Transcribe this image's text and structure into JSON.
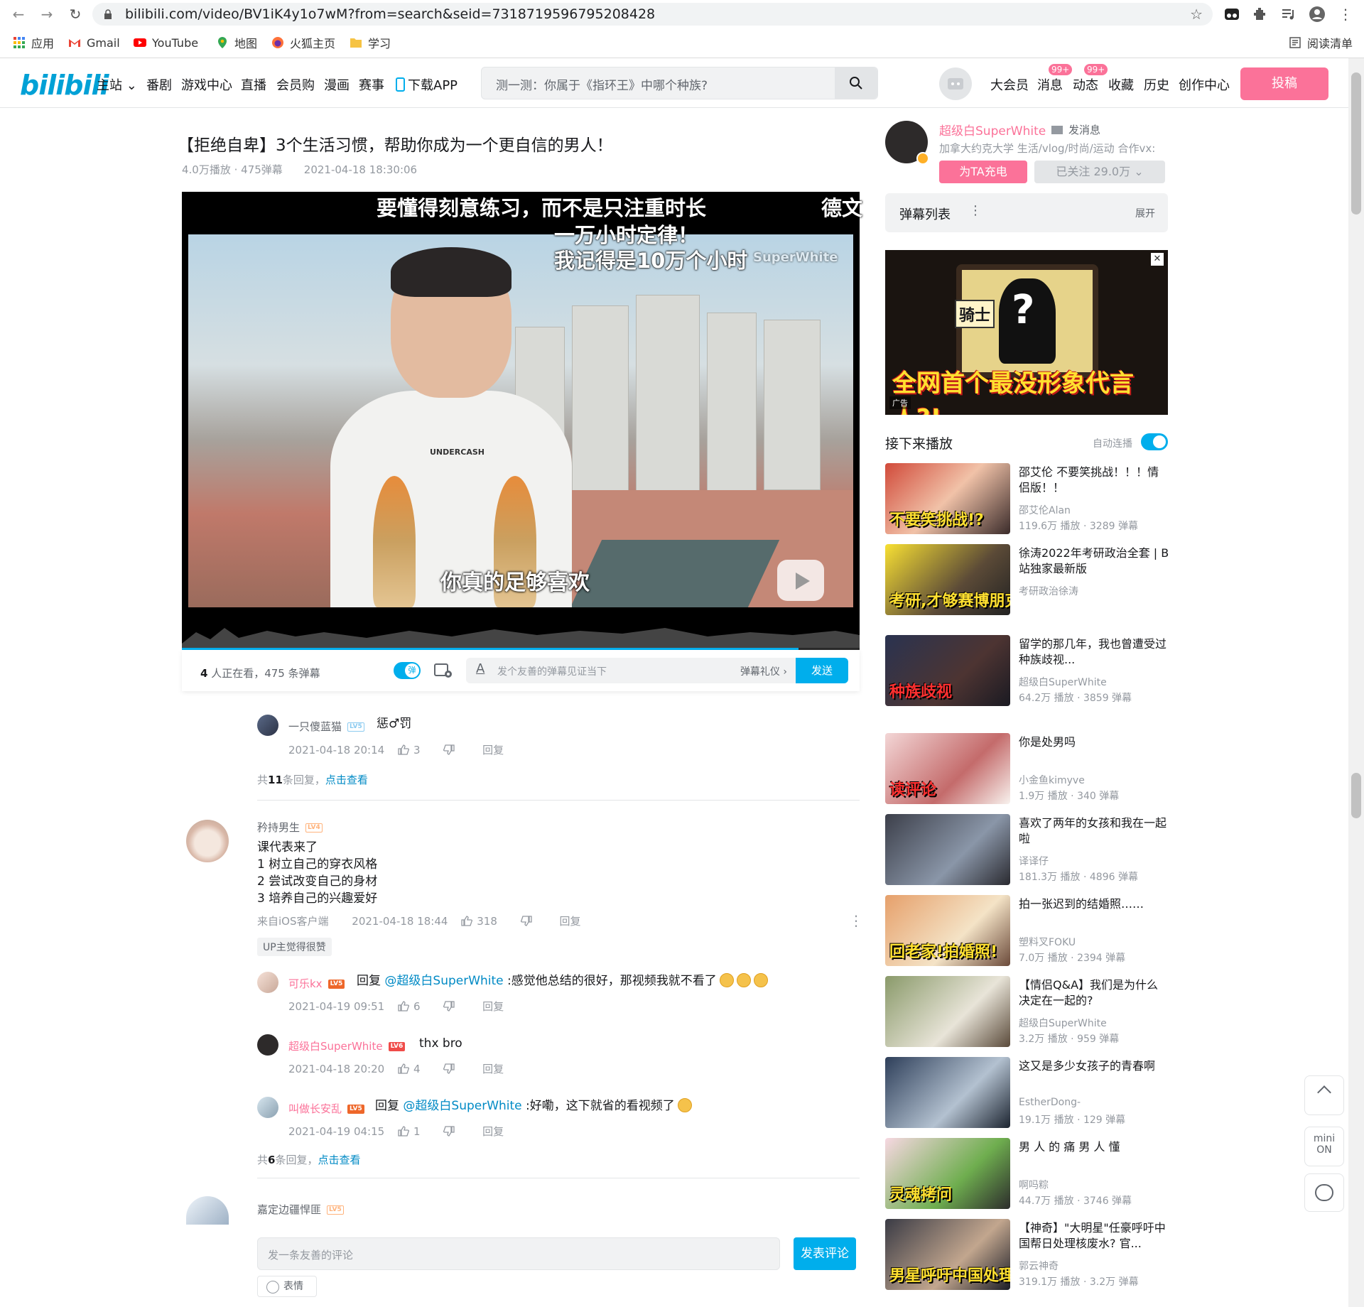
{
  "browser": {
    "url": "bilibili.com/video/BV1iK4y1o7wM?from=search&seid=7318719596795208428",
    "bookmarks": [
      "应用",
      "Gmail",
      "YouTube",
      "地图",
      "火狐主页",
      "学习"
    ],
    "reading_list": "阅读清单"
  },
  "header": {
    "logo": "bilibili",
    "nav": [
      "主站",
      "番剧",
      "游戏中心",
      "直播",
      "会员购",
      "漫画",
      "赛事",
      "下载APP"
    ],
    "search_placeholder": "测一测：你属于《指环王》中哪个种族?",
    "right_nav": [
      "大会员",
      "消息",
      "动态",
      "收藏",
      "历史",
      "创作中心"
    ],
    "badge_msg": "99+",
    "badge_dyn": "99+",
    "upload": "投稿",
    "accent": "#fb7299",
    "blue": "#00aeec"
  },
  "video": {
    "title": "【拒绝自卑】3个生活习惯，帮助你成为一个更自信的男人！",
    "meta": "4.0万播放 · 475弹幕　　2021-04-18 18:30:06",
    "danmaku": [
      "要懂得刻意练习，而不是只注重时长",
      "德文",
      "一万小时定律！",
      "我记得是10万个小时"
    ],
    "watermark": "SuperWhite",
    "shirt_text": "UNDERCASH",
    "subtitle": "你真的足够喜欢",
    "progress": 0.91,
    "watching_count": "4",
    "watching_text": " 人正在看，",
    "danmaku_count": "475 条弹幕",
    "dm_toggle": "弹",
    "dm_placeholder": "发个友善的弹幕见证当下",
    "dm_etiquette": "弹幕礼仪 ›",
    "dm_send": "发送"
  },
  "comments": {
    "reply0": {
      "name": "一只傻蓝猫",
      "level": "LV5",
      "text": "惩♂罚",
      "time": "2021-04-18 20:14",
      "likes": "3",
      "reply": "回复"
    },
    "reply0_count_pre": "共",
    "reply0_count_n": "11",
    "reply0_count_post": "条回复，",
    "view_more": "点击查看",
    "main": {
      "name": "矜持男生",
      "level": "LV4",
      "lines": [
        "课代表来了",
        "1 树立自己的穿衣风格",
        "2 尝试改变自己的身材",
        "3 培养自己的兴趣爱好"
      ],
      "source": "来自iOS客户端",
      "time": "2021-04-18 18:44",
      "likes": "318",
      "reply": "回复",
      "up_liked": "UP主觉得很赞"
    },
    "r1": {
      "name": "可乐kx",
      "level": "LV5",
      "prefix": "回复 ",
      "at": "@超级白SuperWhite",
      "text": " :感觉他总结的很好，那视频我就不看了",
      "time": "2021-04-19 09:51",
      "likes": "6",
      "reply": "回复"
    },
    "r2": {
      "name": "超级白SuperWhite",
      "level": "LV6",
      "text": "thx bro",
      "time": "2021-04-18 20:20",
      "likes": "4",
      "reply": "回复"
    },
    "r3": {
      "name": "叫做长安乱",
      "level": "LV5",
      "prefix": "回复 ",
      "at": "@超级白SuperWhite",
      "text": " :好嘞，这下就省的看视频了",
      "time": "2021-04-19 04:15",
      "likes": "1",
      "reply": "回复"
    },
    "sub_count_pre": "共",
    "sub_count_n": "6",
    "sub_count_post": "条回复，",
    "next": {
      "name": "嘉定边疆悍匪",
      "level": "LV5"
    },
    "input_placeholder": "发一条友善的评论",
    "submit": "发表评论",
    "emoji": "表情"
  },
  "up": {
    "name": "超级白SuperWhite",
    "msg": "发消息",
    "desc": "加拿大约克大学 生活/vlog/时尚/运动 合作vx:",
    "charge": "为TA充电",
    "follow": "已关注 29.0万"
  },
  "danmaku_list": {
    "title": "弹幕列表",
    "expand": "展开"
  },
  "ad": {
    "screen_label": "骑士",
    "headline": "全网首个最没形象代言人?!",
    "tag": "广告"
  },
  "next_up": {
    "title": "接下来播放",
    "autoplay": "自动连播"
  },
  "recommend": [
    {
      "title": "邵艾伦 不要笑挑战！！！情侣版！！",
      "author": "邵艾伦Alan",
      "stats": "119.6万 播放 · 3289 弹幕",
      "cap": "不要笑挑战!?"
    },
    {
      "title": "徐涛2022年考研政治全套 | B站独家最新版",
      "author": "考研政治徐涛",
      "stats": "",
      "cap": "考研,才够赛博朋克!"
    },
    {
      "title": "留学的那几年，我也曾遭受过种族歧视...",
      "author": "超级白SuperWhite",
      "stats": "64.2万 播放 · 3859 弹幕",
      "cap": "种族歧视"
    },
    {
      "title": "你是处男吗",
      "author": "小金鱼kimyve",
      "stats": "1.9万 播放 · 340 弹幕",
      "cap": "读评论"
    },
    {
      "title": "喜欢了两年的女孩和我在一起啦",
      "author": "译译仔",
      "stats": "181.3万 播放 · 4896 弹幕",
      "cap": ""
    },
    {
      "title": "拍一张迟到的结婚照……",
      "author": "塑料叉FOKU",
      "stats": "7.0万 播放 · 2394 弹幕",
      "cap": "回老家!拍婚照!"
    },
    {
      "title": "【情侣Q&A】我们是为什么决定在一起的?",
      "author": "超级白SuperWhite",
      "stats": "3.2万 播放 · 959 弹幕",
      "cap": ""
    },
    {
      "title": "这又是多少女孩子的青春啊",
      "author": "EstherDong-",
      "stats": "19.1万 播放 · 129 弹幕",
      "cap": ""
    },
    {
      "title": "男 人 的 痛 男 人 懂",
      "author": "啊吗粽",
      "stats": "44.7万 播放 · 3746 弹幕",
      "cap": "灵魂拷问"
    },
    {
      "title": "【神奇】\"大明星\"任豪呼吁中国帮日处理核废水? 官...",
      "author": "郭云神奇",
      "stats": "319.1万 播放 · 3.2万 弹幕",
      "cap": "男星呼吁中国处理核废水??"
    }
  ],
  "float": {
    "mini": "mini",
    "on": "ON"
  }
}
